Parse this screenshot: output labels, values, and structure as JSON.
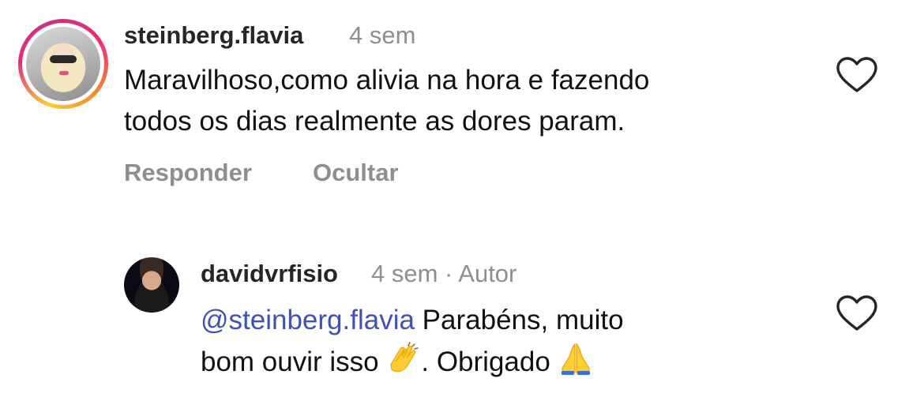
{
  "comments": [
    {
      "username": "steinberg.flavia",
      "time": "4 sem",
      "text_line1": "Maravilhoso,como alivia na hora e fazendo",
      "text_line2": "todos os dias realmente as dores param.",
      "actions": {
        "reply": "Responder",
        "hide": "Ocultar"
      },
      "has_story_ring": true
    },
    {
      "username": "davidvrfisio",
      "time": "4 sem",
      "separator": "·",
      "author_badge": "Autor",
      "mention": "@steinberg.flavia",
      "text_part1": " Parabéns, muito",
      "text_line2_part1": "bom ouvir isso ",
      "text_line2_part2": ". Obrigado ",
      "emojis": [
        "clapping-hands",
        "folded-hands"
      ]
    }
  ],
  "colors": {
    "username": "#262626",
    "meta": "#8e8e8e",
    "mention": "#3f51b5",
    "body": "#111111"
  },
  "icons": [
    "heart-outline-icon",
    "heart-outline-icon"
  ]
}
